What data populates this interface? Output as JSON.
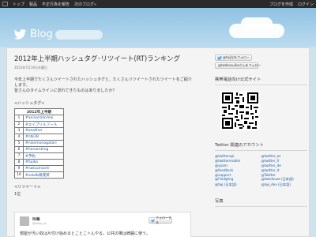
{
  "navbar": {
    "left_links": [
      "トップ",
      "製品",
      "不正行為を報告",
      "次のブログ»"
    ],
    "right_links": [
      "ブログを作成",
      "ログイン"
    ]
  },
  "header": {
    "brand_text": "Blog"
  },
  "post": {
    "title": "2012年上半期ハッシュタグ･リツイート(RT)ランキング",
    "date": "2012年7月19日木曜日",
    "intro_line1": "今年上半期でたくさんツイートされたハッシュタグと、たくさんリツイートされたツイートをご紹介",
    "intro_line2": "します。",
    "intro_line3": "皆さんのタイムラインに流れてきたものはありましたか？",
    "hashtag_section_label": "<ハッシュタグ>",
    "table_header": "2012年上半期",
    "ranking": [
      {
        "rank": "1",
        "tag": "#anisonzanmai"
      },
      {
        "rank": "2",
        "tag": "#エイプリルフール"
      },
      {
        "rank": "3",
        "tag": "#another"
      },
      {
        "rank": "4",
        "tag": "#ntk28"
      },
      {
        "rank": "5",
        "tag": "#nisemonogatari"
      },
      {
        "rank": "6",
        "tag": "#hanamking"
      },
      {
        "rank": "7",
        "tag": "#予約"
      },
      {
        "rank": "8",
        "tag": "#fujiko"
      },
      {
        "rank": "9",
        "tag": "#natsumachi"
      },
      {
        "rank": "10",
        "tag": "#sskdb咲夜斧"
      }
    ],
    "retweet_section_label": "<リツイート>",
    "retweet_rank_label": "1位",
    "retweet_card": {
      "name": "玲華",
      "handle": "@reika_st...",
      "follow_label": "フォローする",
      "body": "部屋が汚い奴は片付け始めるとことこトんやる。公共の場は綺麗に使う。"
    }
  },
  "sidebar": {
    "follow_button_1": "@twjなをフォロー",
    "follow_button_2": "@twdevsuikoさんをフォロー",
    "mobile_heading": "携帯電話向け公式サイト",
    "accounts_heading": "Twitter 関連のアカウント",
    "accounts": [
      "@twitterapi",
      "@twitter_es",
      "@twittermobile",
      "@twitter_fr",
      "@spam",
      "@twitter_de",
      "@feedback",
      "@twitter_it",
      "@support",
      "@Twitter",
      "@Fledgling",
      "@twedsuze (日本語)",
      "@twj (日本語)",
      "@twj_dev (日本語)"
    ],
    "photo_heading": "写真"
  },
  "colors": {
    "link": "#1b5fa8",
    "navbar": "#2a2a2a",
    "twitter_bird": "#55acee"
  }
}
